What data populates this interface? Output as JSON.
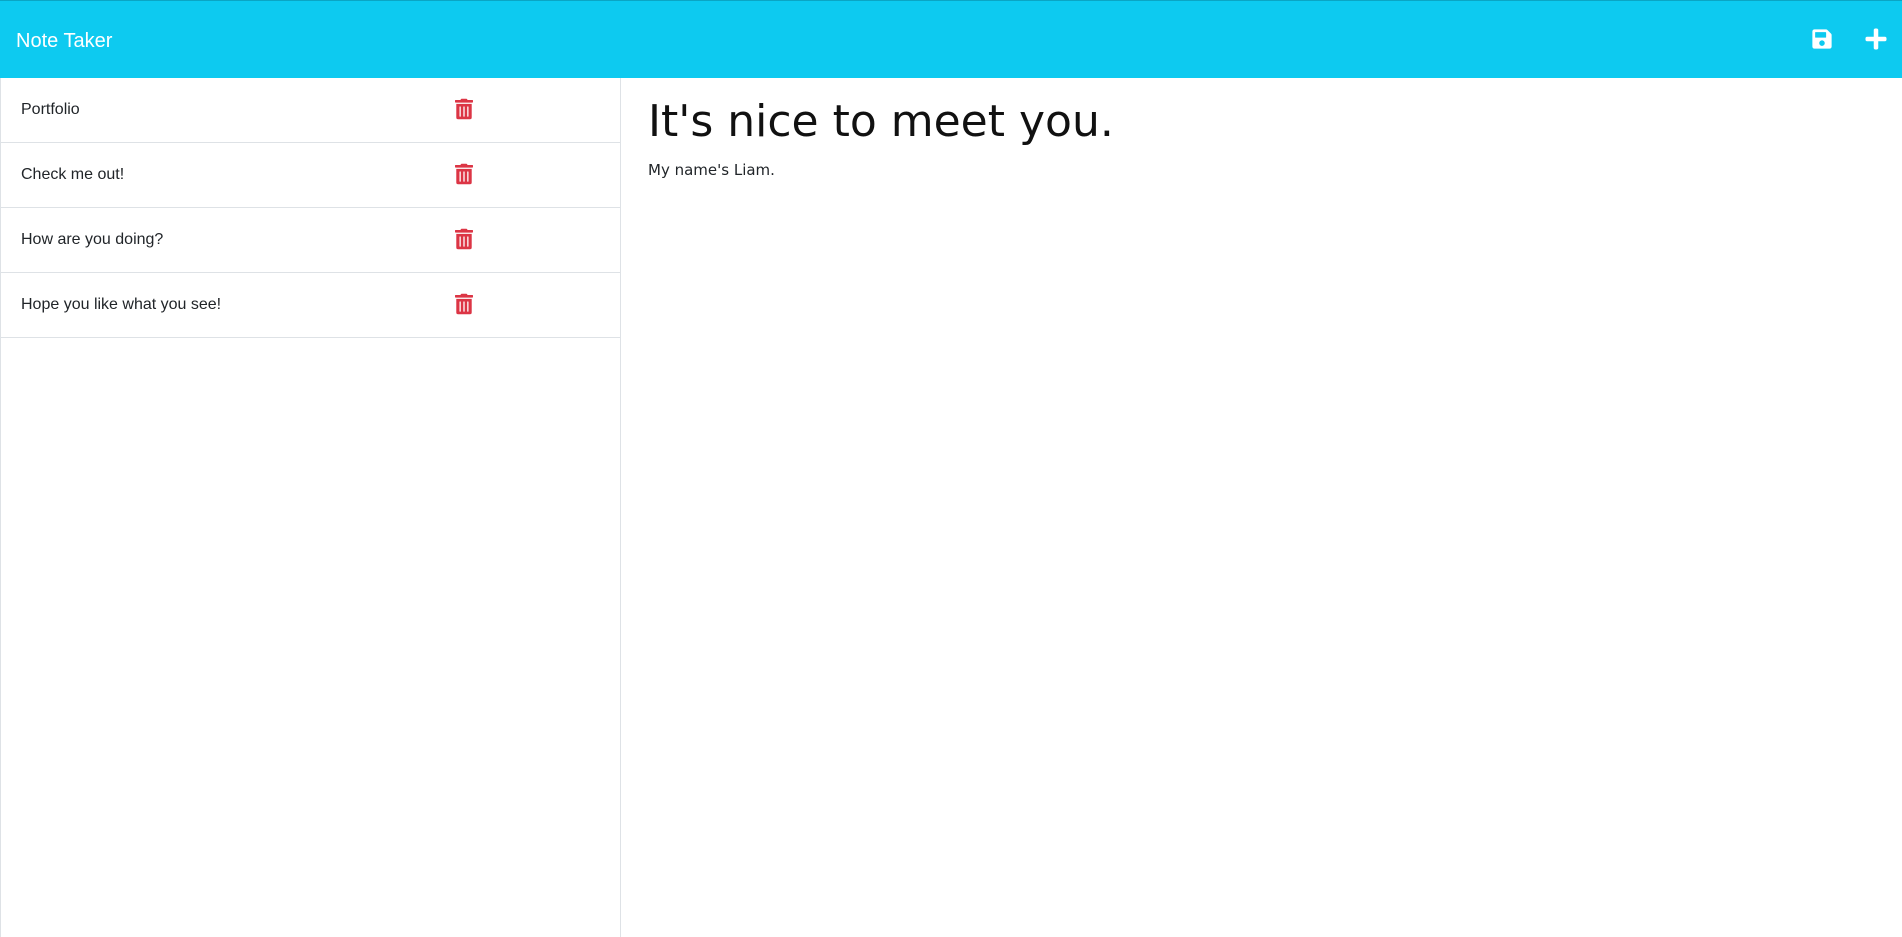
{
  "app": {
    "brand": "Note Taker"
  },
  "toolbar": {
    "save_icon": "save-icon",
    "add_icon": "plus-icon"
  },
  "notes_list": {
    "items": [
      {
        "title": "Portfolio",
        "delete_icon": "trash-icon"
      },
      {
        "title": "Check me out!",
        "delete_icon": "trash-icon"
      },
      {
        "title": "How are you doing?",
        "delete_icon": "trash-icon"
      },
      {
        "title": "Hope you like what you see!",
        "delete_icon": "trash-icon"
      }
    ]
  },
  "editor": {
    "title_value": "It's nice to meet you.",
    "body_value": "My name's Liam."
  },
  "colors": {
    "navbar": "#0dcaf0",
    "delete": "#dc3545"
  }
}
